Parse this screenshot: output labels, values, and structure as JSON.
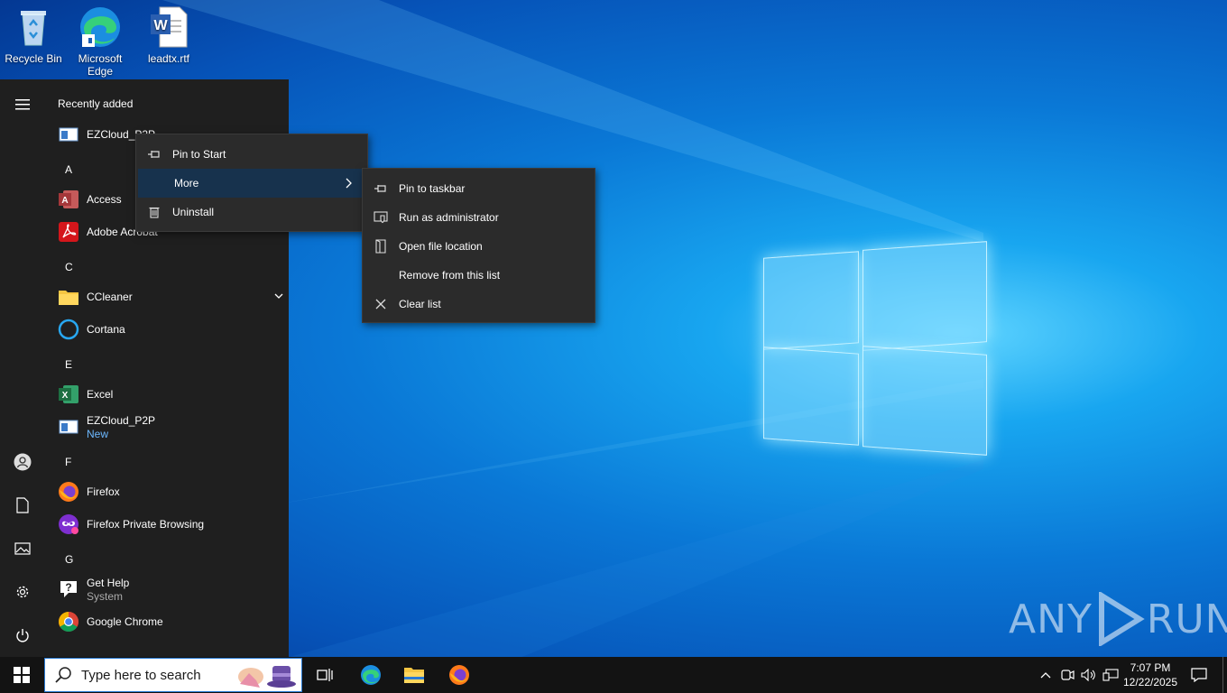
{
  "desktop": {
    "icons": [
      {
        "label": "Recycle Bin",
        "icon": "recycle-bin-icon"
      },
      {
        "label": "Microsoft Edge",
        "icon": "edge-icon"
      },
      {
        "label": "leadtx.rtf",
        "icon": "word-document-icon"
      }
    ]
  },
  "start_menu": {
    "recently_added_title": "Recently added",
    "recent_item": "EZCloud_P2P",
    "letters": {
      "a": "A",
      "c": "C",
      "e": "E",
      "f": "F",
      "g": "G"
    },
    "apps": {
      "access": "Access",
      "acrobat": "Adobe Acrobat",
      "ccleaner": "CCleaner",
      "cortana": "Cortana",
      "excel": "Excel",
      "ezcloud": "EZCloud_P2P",
      "ezcloud_badge": "New",
      "firefox": "Firefox",
      "firefox_private": "Firefox Private Browsing",
      "gethelp": "Get Help",
      "gethelp_sub": "System",
      "chrome": "Google Chrome"
    }
  },
  "context_menu": {
    "pin_to_start": "Pin to Start",
    "more": "More",
    "uninstall": "Uninstall"
  },
  "submenu": {
    "pin_to_taskbar": "Pin to taskbar",
    "run_as_admin": "Run as administrator",
    "open_file_location": "Open file location",
    "remove_from_list": "Remove from this list",
    "clear_list": "Clear list"
  },
  "taskbar": {
    "search_placeholder": "Type here to search",
    "time": "7:07 PM",
    "date": "12/22/2025"
  },
  "watermark": {
    "left": "ANY",
    "right": "RUN"
  },
  "colors": {
    "accent_highlight": "#17324d",
    "start_bg": "#1f1f1f",
    "taskbar_bg": "#131313"
  }
}
